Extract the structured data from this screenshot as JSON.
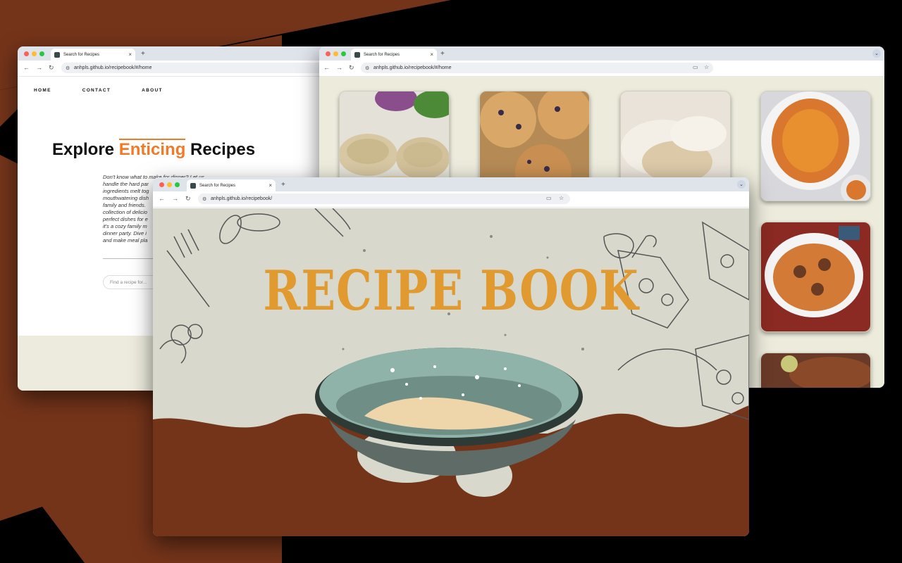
{
  "windows": {
    "w1": {
      "tab_title": "Search for Recipes",
      "url": "anhpls.github.io/recipebook/#/home",
      "nav": [
        "HOME",
        "CONTACT",
        "ABOUT"
      ],
      "hero": {
        "prefix": "Explore ",
        "highlight": "Enticing",
        "suffix": " Recipes"
      },
      "description": "Don't know what to make for dinner? Let us\nhandle the hard par\ningredients melt tog\nmouthwatering dish\nfamily and friends.\ncollection of delicio\nperfect dishes for e\nit's a cozy family m\ndinner party. Dive i\nand make meal pla",
      "search_placeholder": "Find a recipe for..."
    },
    "w2": {
      "tab_title": "Search for Recipes",
      "url": "anhpls.github.io/recipebook/#/home"
    },
    "w3": {
      "tab_title": "Search for Recipes",
      "url": "anhpls.github.io/recipebook/",
      "title": "RECIPE BOOK"
    }
  },
  "colors": {
    "accent_orange": "#f07a26",
    "title_gold": "#e09a30",
    "brown": "#74341a",
    "cream": "#ecebdc",
    "bowl": "#8fb3a9"
  },
  "icons": [
    "back-icon",
    "forward-icon",
    "reload-icon",
    "tune-icon",
    "cast-icon",
    "star-icon",
    "close-icon",
    "plus-icon",
    "chevron-down-icon"
  ]
}
